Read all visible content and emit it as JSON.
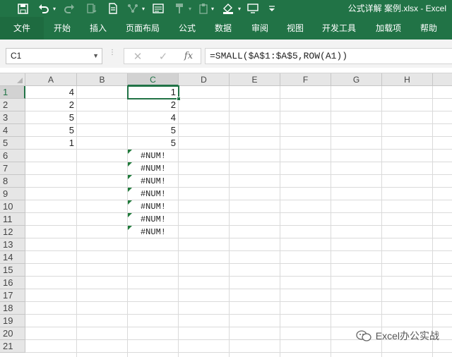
{
  "window": {
    "title": "公式详解 案例.xlsx - Excel"
  },
  "ribbon": {
    "tabs": [
      "文件",
      "开始",
      "插入",
      "页面布局",
      "公式",
      "数据",
      "审阅",
      "视图",
      "开发工具",
      "加载项",
      "帮助"
    ]
  },
  "formula_bar": {
    "name_box": "C1",
    "formula": "=SMALL($A$1:$A$5,ROW(A1))",
    "fx_label": "fx"
  },
  "sheet": {
    "columns": [
      "A",
      "B",
      "C",
      "D",
      "E",
      "F",
      "G",
      "H"
    ],
    "rows": [
      "1",
      "2",
      "3",
      "4",
      "5",
      "6",
      "7",
      "8",
      "9",
      "10",
      "11",
      "12",
      "13",
      "14",
      "15",
      "16",
      "17",
      "18",
      "19",
      "20",
      "21"
    ],
    "selected_cell": "C1",
    "column_a": [
      "4",
      "2",
      "5",
      "5",
      "1"
    ],
    "column_c": [
      "1",
      "2",
      "4",
      "5",
      "5",
      "#NUM!",
      "#NUM!",
      "#NUM!",
      "#NUM!",
      "#NUM!",
      "#NUM!",
      "#NUM!"
    ]
  },
  "watermark": {
    "text": "Excel办公实战"
  },
  "colors": {
    "accent": "#217346",
    "error_marker": "#1f7a3a"
  }
}
